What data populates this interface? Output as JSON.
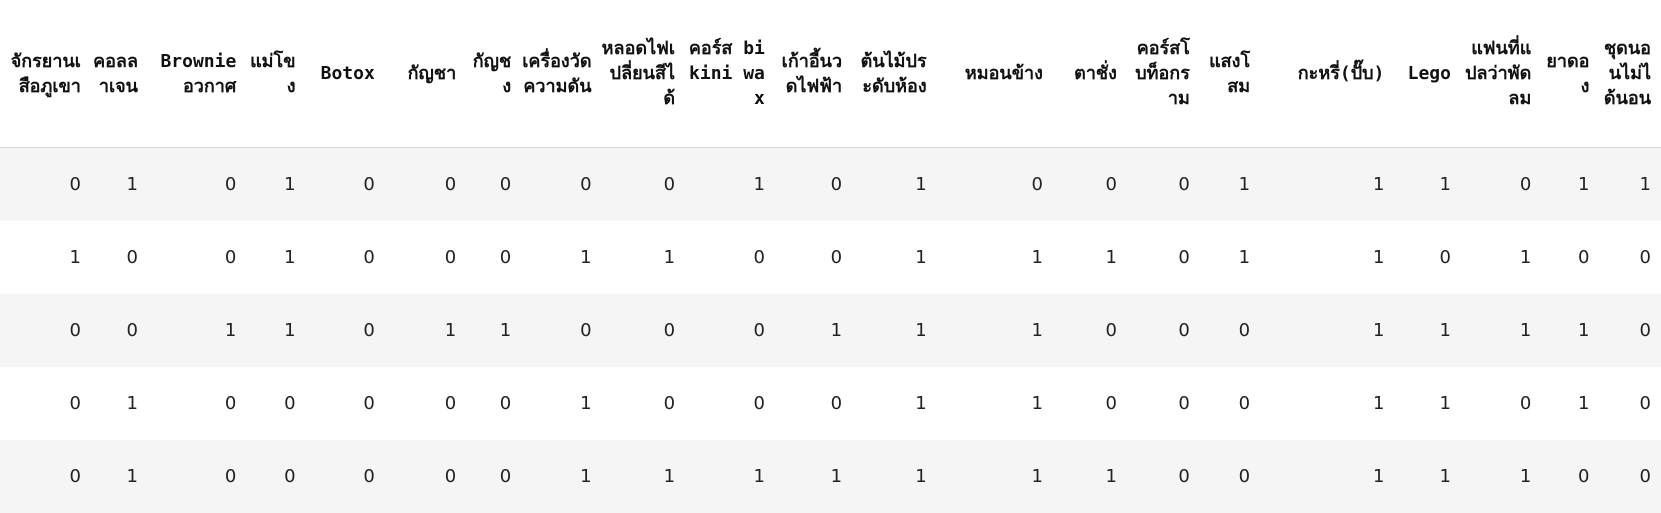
{
  "table": {
    "columns": [
      "จักรยานเสือภูเขา",
      "คอลลาเจน",
      "Brownie อวกาศ",
      "แม่โขง",
      "Botox",
      "กัญชา",
      "กัญชง",
      "เครื่องวัดความดัน",
      "หลอดไฟเปลี่ยนสีได้",
      "คอร์ส bikini wax",
      "เก้าอี้นวดไฟฟ้า",
      "ต้นไม้ประดับห้อง",
      "หมอนข้าง",
      "ตาชั่ง",
      "คอร์สโบท็อกราม",
      "แสงโสม",
      "กะหรี่(ปั๊บ)",
      "Lego",
      "แฟนที่แปลว่าพัดลม",
      "ยาดอง",
      "ชุดนอนไม่ได้นอน"
    ],
    "rows": [
      [
        "0",
        "1",
        "0",
        "1",
        "0",
        "0",
        "0",
        "0",
        "0",
        "1",
        "0",
        "1",
        "0",
        "0",
        "0",
        "1",
        "1",
        "1",
        "0",
        "1",
        "1"
      ],
      [
        "1",
        "0",
        "0",
        "1",
        "0",
        "0",
        "0",
        "1",
        "1",
        "0",
        "0",
        "1",
        "1",
        "1",
        "0",
        "1",
        "1",
        "0",
        "1",
        "0",
        "0"
      ],
      [
        "0",
        "0",
        "1",
        "1",
        "0",
        "1",
        "1",
        "0",
        "0",
        "0",
        "1",
        "1",
        "1",
        "0",
        "0",
        "0",
        "1",
        "1",
        "1",
        "1",
        "0"
      ],
      [
        "0",
        "1",
        "0",
        "0",
        "0",
        "0",
        "0",
        "1",
        "0",
        "0",
        "0",
        "1",
        "1",
        "0",
        "0",
        "0",
        "1",
        "1",
        "0",
        "1",
        "0"
      ],
      [
        "0",
        "1",
        "0",
        "0",
        "0",
        "0",
        "0",
        "1",
        "1",
        "1",
        "1",
        "1",
        "1",
        "1",
        "0",
        "0",
        "1",
        "1",
        "1",
        "0",
        "0"
      ]
    ]
  }
}
